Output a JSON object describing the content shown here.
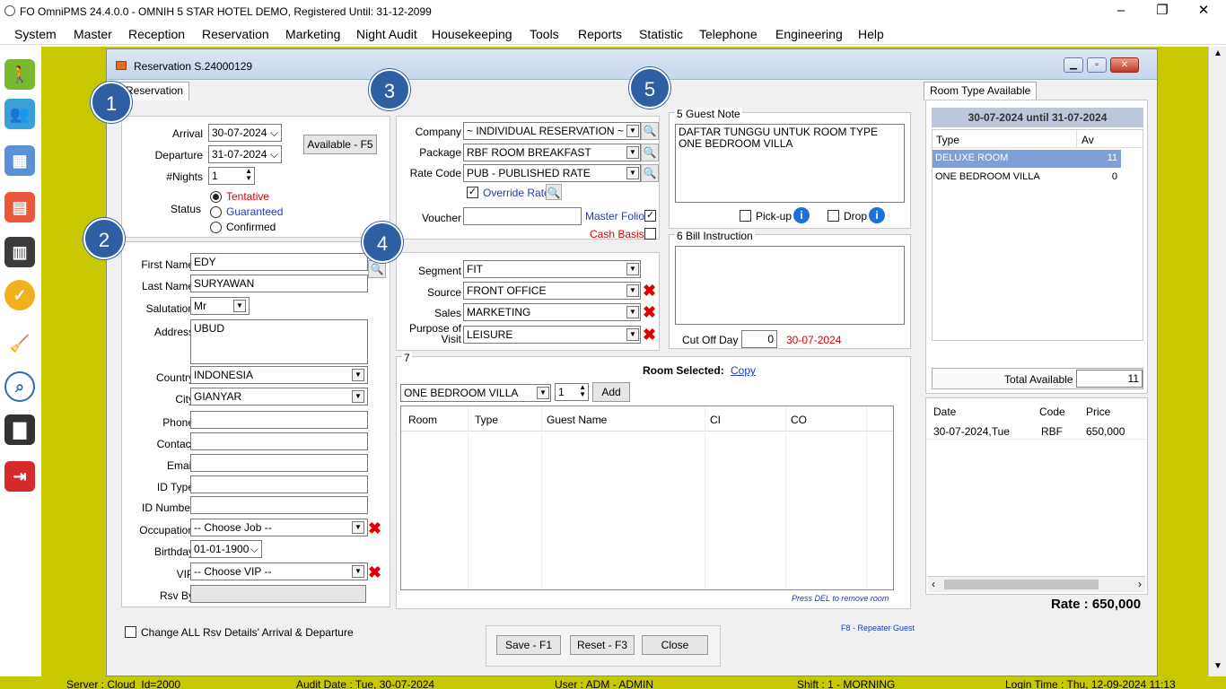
{
  "window": {
    "title": "FO OmniPMS 24.4.0.0 - OMNIH 5 STAR HOTEL DEMO, Registered Until: 31-12-2099",
    "min": "–",
    "max": "❐",
    "close": "✕"
  },
  "menu": [
    "System",
    "Master",
    "Reception",
    "Reservation",
    "Marketing",
    "Night Audit",
    "Housekeeping",
    "Tools",
    "Reports",
    "Statistic",
    "Telephone",
    "Engineering",
    "Help"
  ],
  "status": {
    "server": "Server : Cloud_Id=2000",
    "audit": "Audit Date : Tue, 30-07-2024",
    "user": "User : ADM - ADMIN",
    "shift": "Shift : 1 - MORNING",
    "login": "Login Time : Thu, 12-09-2024 11:13"
  },
  "form": {
    "title": "Reservation S.24000129",
    "tab": "Reservation",
    "badges": [
      "1",
      "2",
      "3",
      "4",
      "5"
    ],
    "stay": {
      "arrival_label": "Arrival",
      "arrival": "30-07-2024",
      "departure_label": "Departure",
      "departure": "31-07-2024",
      "nights_label": "#Nights",
      "nights": "1",
      "available_btn": "Available - F5",
      "status_label": "Status",
      "tentative": "Tentative",
      "guaranteed": "Guaranteed",
      "confirmed": "Confirmed"
    },
    "guest": {
      "first_name_label": "First Name",
      "first_name": "EDY",
      "last_name_label": "Last Name",
      "last_name": "SURYAWAN",
      "salutation_label": "Salutation",
      "salutation": "Mr",
      "address_label": "Address",
      "address": "UBUD",
      "country_label": "Country",
      "country": "INDONESIA",
      "city_label": "City",
      "city": "GIANYAR",
      "phone_label": "Phone",
      "contact_label": "Contact",
      "email_label": "Email",
      "idtype_label": "ID Type",
      "idnumber_label": "ID Number",
      "occupation_label": "Occupation",
      "occupation": "-- Choose Job --",
      "birthday_label": "Birthday",
      "birthday": "01-01-1900",
      "vip_label": "VIP",
      "vip": "-- Choose VIP --",
      "rsvby_label": "Rsv By"
    },
    "rate": {
      "company_label": "Company",
      "company": "~ INDIVIDUAL RESERVATION ~",
      "package_label": "Package",
      "package": "RBF ROOM BREAKFAST",
      "ratecode_label": "Rate Code",
      "ratecode": "PUB - PUBLISHED RATE",
      "override": "Override Rate",
      "voucher_label": "Voucher",
      "master_folio": "Master Folio",
      "cash_basis": "Cash Basis"
    },
    "market": {
      "segment_label": "Segment",
      "segment": "FIT",
      "source_label": "Source",
      "source": "FRONT OFFICE",
      "sales_label": "Sales",
      "sales": "MARKETING",
      "purpose_label1": "Purpose of",
      "purpose_label2": "Visit",
      "purpose": "LEISURE"
    },
    "note": {
      "guest_note_title": "5 Guest Note",
      "guest_note": "DAFTAR TUNGGU UNTUK ROOM TYPE ONE BEDROOM VILLA",
      "pickup": "Pick-up",
      "drop": "Drop",
      "bill_title": "6 Bill Instruction",
      "cutoff_label": "Cut Off Day",
      "cutoff": "0",
      "cutoff_date": "30-07-2024"
    },
    "rooms": {
      "section": "7",
      "selected_label": "Room Selected:",
      "copy": "Copy",
      "room_type": "ONE BEDROOM VILLA",
      "qty": "1",
      "add": "Add",
      "cols": [
        "Room",
        "Type",
        "Guest Name",
        "CI",
        "CO"
      ],
      "hint": "Press DEL to remove room"
    },
    "change_all": "Change ALL Rsv Details' Arrival & Departure",
    "repeater": "F8 - Repeater Guest",
    "buttons": {
      "save": "Save - F1",
      "reset": "Reset - F3",
      "close": "Close"
    },
    "avail": {
      "tab": "Room Type Available",
      "period": "30-07-2024 until 31-07-2024",
      "col_type": "Type",
      "col_av": "Av",
      "rows": [
        {
          "type": "DELUXE ROOM",
          "av": "11"
        },
        {
          "type": "ONE BEDROOM VILLA",
          "av": "0"
        }
      ],
      "total_label": "Total Available",
      "total": "11"
    },
    "prices": {
      "col_date": "Date",
      "col_code": "Code",
      "col_price": "Price",
      "rows": [
        {
          "date": "30-07-2024,Tue",
          "code": "RBF",
          "price": "650,000"
        }
      ]
    },
    "rate_total": "Rate : 650,000"
  }
}
